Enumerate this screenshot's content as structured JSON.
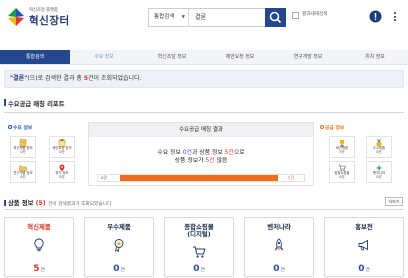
{
  "header": {
    "logo_sub": "혁신조달 플랫폼",
    "logo_main": "혁신장터",
    "search_category": "통합검색",
    "search_query": "결론",
    "result_search_label": "결과내재검색"
  },
  "tabs": [
    "통합검색",
    "수요 정보",
    "혁신조달 정보",
    "제안요청 정보",
    "연구개발 정보",
    "위치 정보"
  ],
  "alert": {
    "open_quote": "\"",
    "keyword": "결론",
    "close_quote": "\"",
    "text1": "(으)로 검색한 결과 총 ",
    "count": "5",
    "text2": "건이 조회되었습니다."
  },
  "report": {
    "title": "수요공급 매칭 리포트",
    "demand_label": "수요 정보",
    "supply_label": "공급 정보",
    "demand_items": [
      {
        "label": "혁신제품 정보",
        "count": "0건"
      },
      {
        "label": "제안요청 정보",
        "count": "0건"
      },
      {
        "label": "연구개발 정보",
        "count": "0건"
      },
      {
        "label": "위치 정보",
        "count": "0건"
      }
    ],
    "supply_items": [
      {
        "label": "혁신제품",
        "count": "5건"
      },
      {
        "label": "우수제품",
        "count": "0건"
      },
      {
        "label": "종합쇼핑몰",
        "count": "0건"
      },
      {
        "label": "벤처나라",
        "count": "0건"
      }
    ],
    "center_title": "수요공급 매칭 결과",
    "msg1_a": "수요 정보 ",
    "msg1_b": "0건",
    "msg1_c": "과 상품 정보 ",
    "msg1_d": "5건",
    "msg1_e": "으로",
    "msg2_a": "상품 정보가 ",
    "msg2_b": "5건",
    "msg2_c": " 많음",
    "bar_left": "0건",
    "bar_right": "5건"
  },
  "product": {
    "title": "상품 정보 ",
    "count": "(5)",
    "subtitle": "건이 검색결과가 조회되었습니다.",
    "more": "더보기",
    "cards": [
      {
        "name": "혁신제품",
        "count": "5",
        "unit": "건"
      },
      {
        "name": "우수제품",
        "count": "0",
        "unit": "건"
      },
      {
        "name": "종합쇼핑몰",
        "name2": "(디지털)",
        "count": "0",
        "unit": "건"
      },
      {
        "name": "벤처나라",
        "count": "0",
        "unit": "건"
      },
      {
        "name": "홍보전",
        "count": "0",
        "unit": "건"
      }
    ]
  },
  "colors": {
    "primary": "#24478f",
    "accent": "#e0342b",
    "orange": "#f26a1b",
    "count_blue": "#2b4db0"
  }
}
